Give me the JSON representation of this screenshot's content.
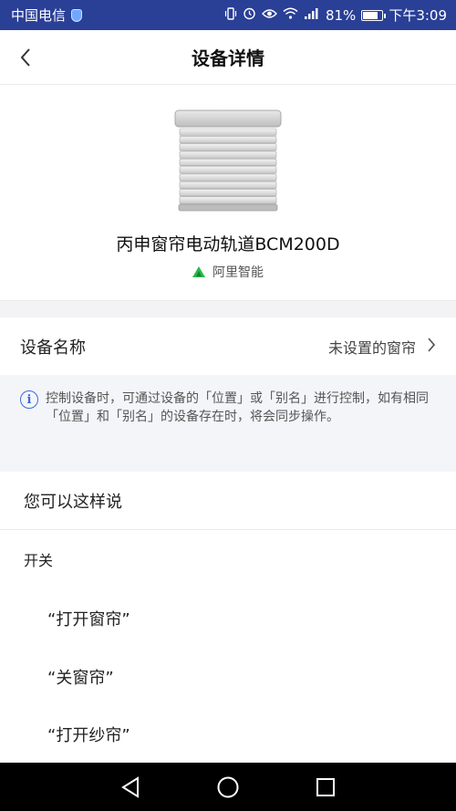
{
  "status_bar": {
    "carrier": "中国电信",
    "battery_text": "81%",
    "battery_level": 0.81,
    "time": "下午3:09",
    "icons": [
      "shield-icon",
      "vibrate-icon",
      "alarm-icon",
      "eye-icon",
      "wifi-icon",
      "signal-icon",
      "battery-icon"
    ]
  },
  "header": {
    "title": "设备详情",
    "back_icon": "chevron-left-icon"
  },
  "device": {
    "name": "丙申窗帘电动轨道BCM200D",
    "brand": "阿里智能",
    "image": "window-blind-image",
    "brand_color": "#2db84d"
  },
  "settings": {
    "name_label": "设备名称",
    "name_value": "未设置的窗帘"
  },
  "info": {
    "text": "控制设备时，可通过设备的「位置」或「别名」进行控制，如有相同「位置」和「别名」的设备存在时，将会同步操作。"
  },
  "voice": {
    "header": "您可以这样说",
    "section_title": "开关",
    "commands": [
      "“打开窗帘”",
      "“关窗帘”",
      "“打开纱帘”"
    ]
  },
  "colors": {
    "status_bar": "#2a3f96",
    "info_icon": "#3a6bd6"
  }
}
